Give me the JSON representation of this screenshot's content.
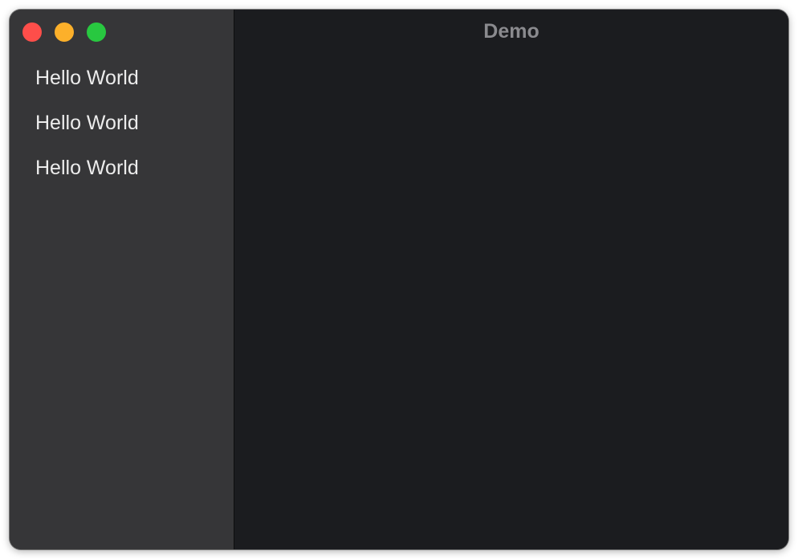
{
  "window": {
    "title": "Demo"
  },
  "traffic_lights": {
    "close_color": "#fe4e4a",
    "minimize_color": "#fcb02a",
    "zoom_color": "#28c840"
  },
  "sidebar": {
    "items": [
      {
        "label": "Hello World"
      },
      {
        "label": "Hello World"
      },
      {
        "label": "Hello World"
      }
    ]
  }
}
